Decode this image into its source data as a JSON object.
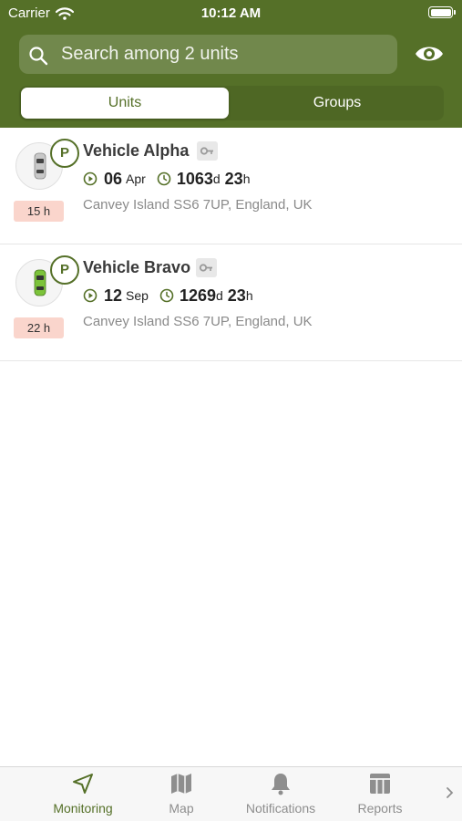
{
  "status_bar": {
    "carrier": "Carrier",
    "time": "10:12 AM"
  },
  "search": {
    "placeholder": "Search among 2 units"
  },
  "segments": {
    "units": "Units",
    "groups": "Groups"
  },
  "units": [
    {
      "name": "Vehicle Alpha",
      "park_badge": "P",
      "duration": "15 h",
      "date_day": "06",
      "date_month": "Apr",
      "age_days": "1063",
      "age_d_unit": "d",
      "age_hours": "23",
      "age_h_unit": "h",
      "address": "Canvey Island SS6 7UP, England, UK",
      "car_color": "#c8c8c8"
    },
    {
      "name": "Vehicle Bravo",
      "park_badge": "P",
      "duration": "22 h",
      "date_day": "12",
      "date_month": "Sep",
      "age_days": "1269",
      "age_d_unit": "d",
      "age_hours": "23",
      "age_h_unit": "h",
      "address": "Canvey Island SS6 7UP, England, UK",
      "car_color": "#7cc33a"
    }
  ],
  "tabbar": {
    "monitoring": "Monitoring",
    "map": "Map",
    "notifications": "Notifications",
    "reports": "Reports"
  },
  "colors": {
    "brand": "#557028",
    "duration_badge": "#fad5cc"
  }
}
